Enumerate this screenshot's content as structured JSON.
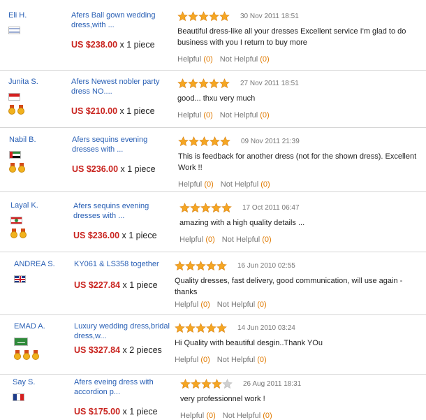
{
  "reviews": [
    {
      "name": "Eli H.",
      "country": "Israel",
      "medals": 0,
      "product": "Afers Ball gown wedding dress,with ...",
      "price": "US $238.00",
      "qty": "x 1 piece",
      "stars": 5,
      "date": "30 Nov 2011 18:51",
      "comment": "Beautiful dress-like all your dresses Excellent service I'm glad to do business with you I return to buy more",
      "helpful_label": "Helpful",
      "helpful_count": "(0)",
      "not_helpful_label": "Not Helpful",
      "not_helpful_count": "(0)"
    },
    {
      "name": "Junita S.",
      "country": "Indonesia",
      "medals": 2,
      "product": "Afers Newest nobler party dress NO....",
      "price": "US $210.00",
      "qty": "x 1 piece",
      "stars": 5,
      "date": "27 Nov 2011 18:51",
      "comment": "good... thxu very much",
      "helpful_label": "Helpful",
      "helpful_count": "(0)",
      "not_helpful_label": "Not Helpful",
      "not_helpful_count": "(0)"
    },
    {
      "name": "Nabil B.",
      "country": "UAE",
      "medals": 2,
      "product": "Afers sequins evening dresses with ...",
      "price": "US $236.00",
      "qty": "x 1 piece",
      "stars": 5,
      "date": "09 Nov 2011 21:39",
      "comment": "This is feedback for another dress (not for the shown dress). Excellent Work !!",
      "helpful_label": "Helpful",
      "helpful_count": "(0)",
      "not_helpful_label": "Not Helpful",
      "not_helpful_count": "(0)"
    },
    {
      "name": "Layal K.",
      "country": "Lebanon",
      "medals": 2,
      "product": "Afers sequins evening dresses with ...",
      "price": "US $236.00",
      "qty": "x 1 piece",
      "stars": 5,
      "date": "17 Oct 2011 06:47",
      "comment": "amazing with a high quality details ...",
      "helpful_label": "Helpful",
      "helpful_count": "(0)",
      "not_helpful_label": "Not Helpful",
      "not_helpful_count": "(0)"
    },
    {
      "name": "ANDREA S.",
      "country": "United Kingdom",
      "medals": 0,
      "product": "KY061 & LS358 together",
      "price": "US $227.84",
      "qty": "x 1 piece",
      "stars": 5,
      "date": "16 Jun 2010 02:55",
      "comment": "Quality dresses, fast delivery, good communication, will use again - thanks",
      "helpful_label": "Helpful",
      "helpful_count": "(0)",
      "not_helpful_label": "Not Helpful",
      "not_helpful_count": "(0)"
    },
    {
      "name": "EMAD A.",
      "country": "Saudi Arabia",
      "medals": 3,
      "product": "Luxury wedding dress,bridal dress,w...",
      "price": "US $327.84",
      "qty": "x 2 pieces",
      "stars": 5,
      "date": "14 Jun 2010 03:24",
      "comment": "Hi Quality with beautiful desgin..Thank YOu",
      "helpful_label": "Helpful",
      "helpful_count": "(0)",
      "not_helpful_label": "Not Helpful",
      "not_helpful_count": "(0)"
    },
    {
      "name": "Say S.",
      "country": "France",
      "medals": 0,
      "product": "Afers eveing dress with accordion p...",
      "price": "US $175.00",
      "qty": "x 1 piece",
      "stars": 4,
      "date": "26 Aug 2011 18:31",
      "comment": "very professionnel work !",
      "helpful_label": "Helpful",
      "helpful_count": "(0)",
      "not_helpful_label": "Not Helpful",
      "not_helpful_count": "(0)"
    }
  ],
  "colors": {
    "star_filled": "#f5a623",
    "star_empty": "#d0d0d0",
    "price": "#c9241f",
    "link": "#2a60b5",
    "count": "#e07a00"
  }
}
